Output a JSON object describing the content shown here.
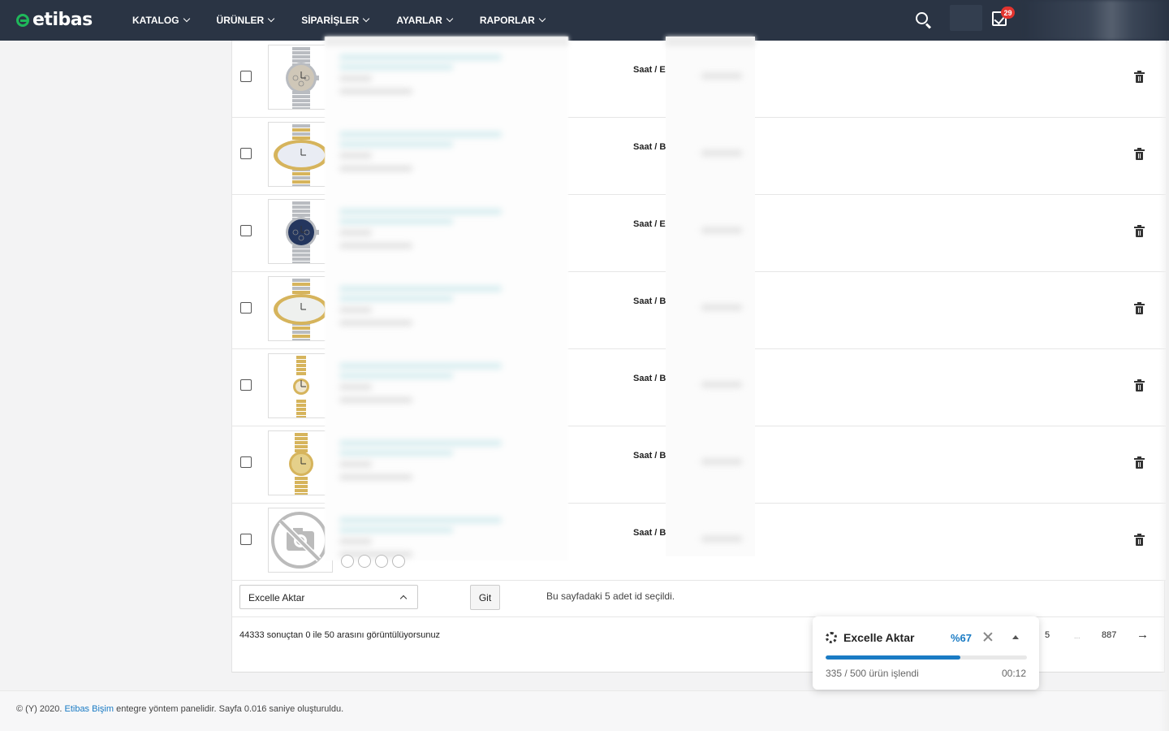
{
  "brand": {
    "name": "etibas"
  },
  "nav": {
    "menu": [
      {
        "label": "KATALOG"
      },
      {
        "label": "ÜRÜNLER"
      },
      {
        "label": "SİPARİŞLER"
      },
      {
        "label": "AYARLAR"
      },
      {
        "label": "RAPORLAR"
      }
    ],
    "task_badge": "29",
    "icons": {
      "search": "search-icon",
      "tasks": "task-check-icon"
    }
  },
  "products": [
    {
      "category": "Saat / Er",
      "image": "silver-chronograph-watch"
    },
    {
      "category": "Saat / Ba",
      "image": "two-tone-oval-watch"
    },
    {
      "category": "Saat / Er",
      "image": "blue-dial-chronograph-watch"
    },
    {
      "category": "Saat / Ba",
      "image": "two-tone-pearl-oval-watch"
    },
    {
      "category": "Saat / Ba",
      "image": "gold-small-ladies-watch"
    },
    {
      "category": "Saat / Ba",
      "image": "gold-ladies-watch"
    },
    {
      "category": "Saat / Ba",
      "image": "no-image-placeholder"
    }
  ],
  "bulk": {
    "action_selected": "Excelle Aktar",
    "go_label": "Git",
    "selection_info": "Bu sayfadaki 5 adet id seçildi."
  },
  "pagination": {
    "summary": "44333 sonuçtan 0 ile 50 arasını görüntülüyorsunuz",
    "page_5": "5",
    "ellipsis": "...",
    "last_page": "887",
    "next": "→"
  },
  "export_popup": {
    "title": "Excelle Aktar",
    "percent_label": "%67",
    "progress": 0.67,
    "status": "335 / 500 ürün işlendi",
    "elapsed": "00:12"
  },
  "footer": {
    "prefix": "© (Y) 2020.",
    "link": "Etibas Bişim",
    "suffix": "entegre yöntem panelidir. Sayfa 0.016 saniye oluşturuldu."
  },
  "colors": {
    "nav_bg": "#2a3444",
    "accent": "#1a7bc4",
    "brand_green": "#1fb85a",
    "badge_red": "#e3342f"
  }
}
